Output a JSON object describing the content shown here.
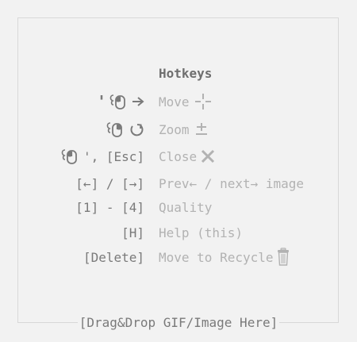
{
  "hotkeys": {
    "title": "Hotkeys",
    "rows": [
      {
        "keys": "'",
        "action": "Move"
      },
      {
        "keys": "",
        "action": "Zoom"
      },
      {
        "keys": "', [Esc]",
        "action": "Close"
      },
      {
        "keys": "[←] / [→]",
        "action": "Prev← / next→ image"
      },
      {
        "keys": "[1] - [4]",
        "action": "Quality"
      },
      {
        "keys": "[H]",
        "action": "Help (this)"
      },
      {
        "keys": "[Delete]",
        "action": "Move to Recycle"
      }
    ]
  },
  "dropzone": {
    "label": "[Drag&Drop GIF/Image Here]"
  },
  "colors": {
    "key_text": "#7a7a7a",
    "action_text": "#b2b2b2",
    "border": "#d8d8d8",
    "background": "#f2f2f2"
  },
  "icons": [
    "mouse-click-icon",
    "arrow-right-icon",
    "move-cross-icon",
    "rotate-icon",
    "zoom-plus-minus-icon",
    "close-x-icon",
    "recycle-bin-icon"
  ]
}
